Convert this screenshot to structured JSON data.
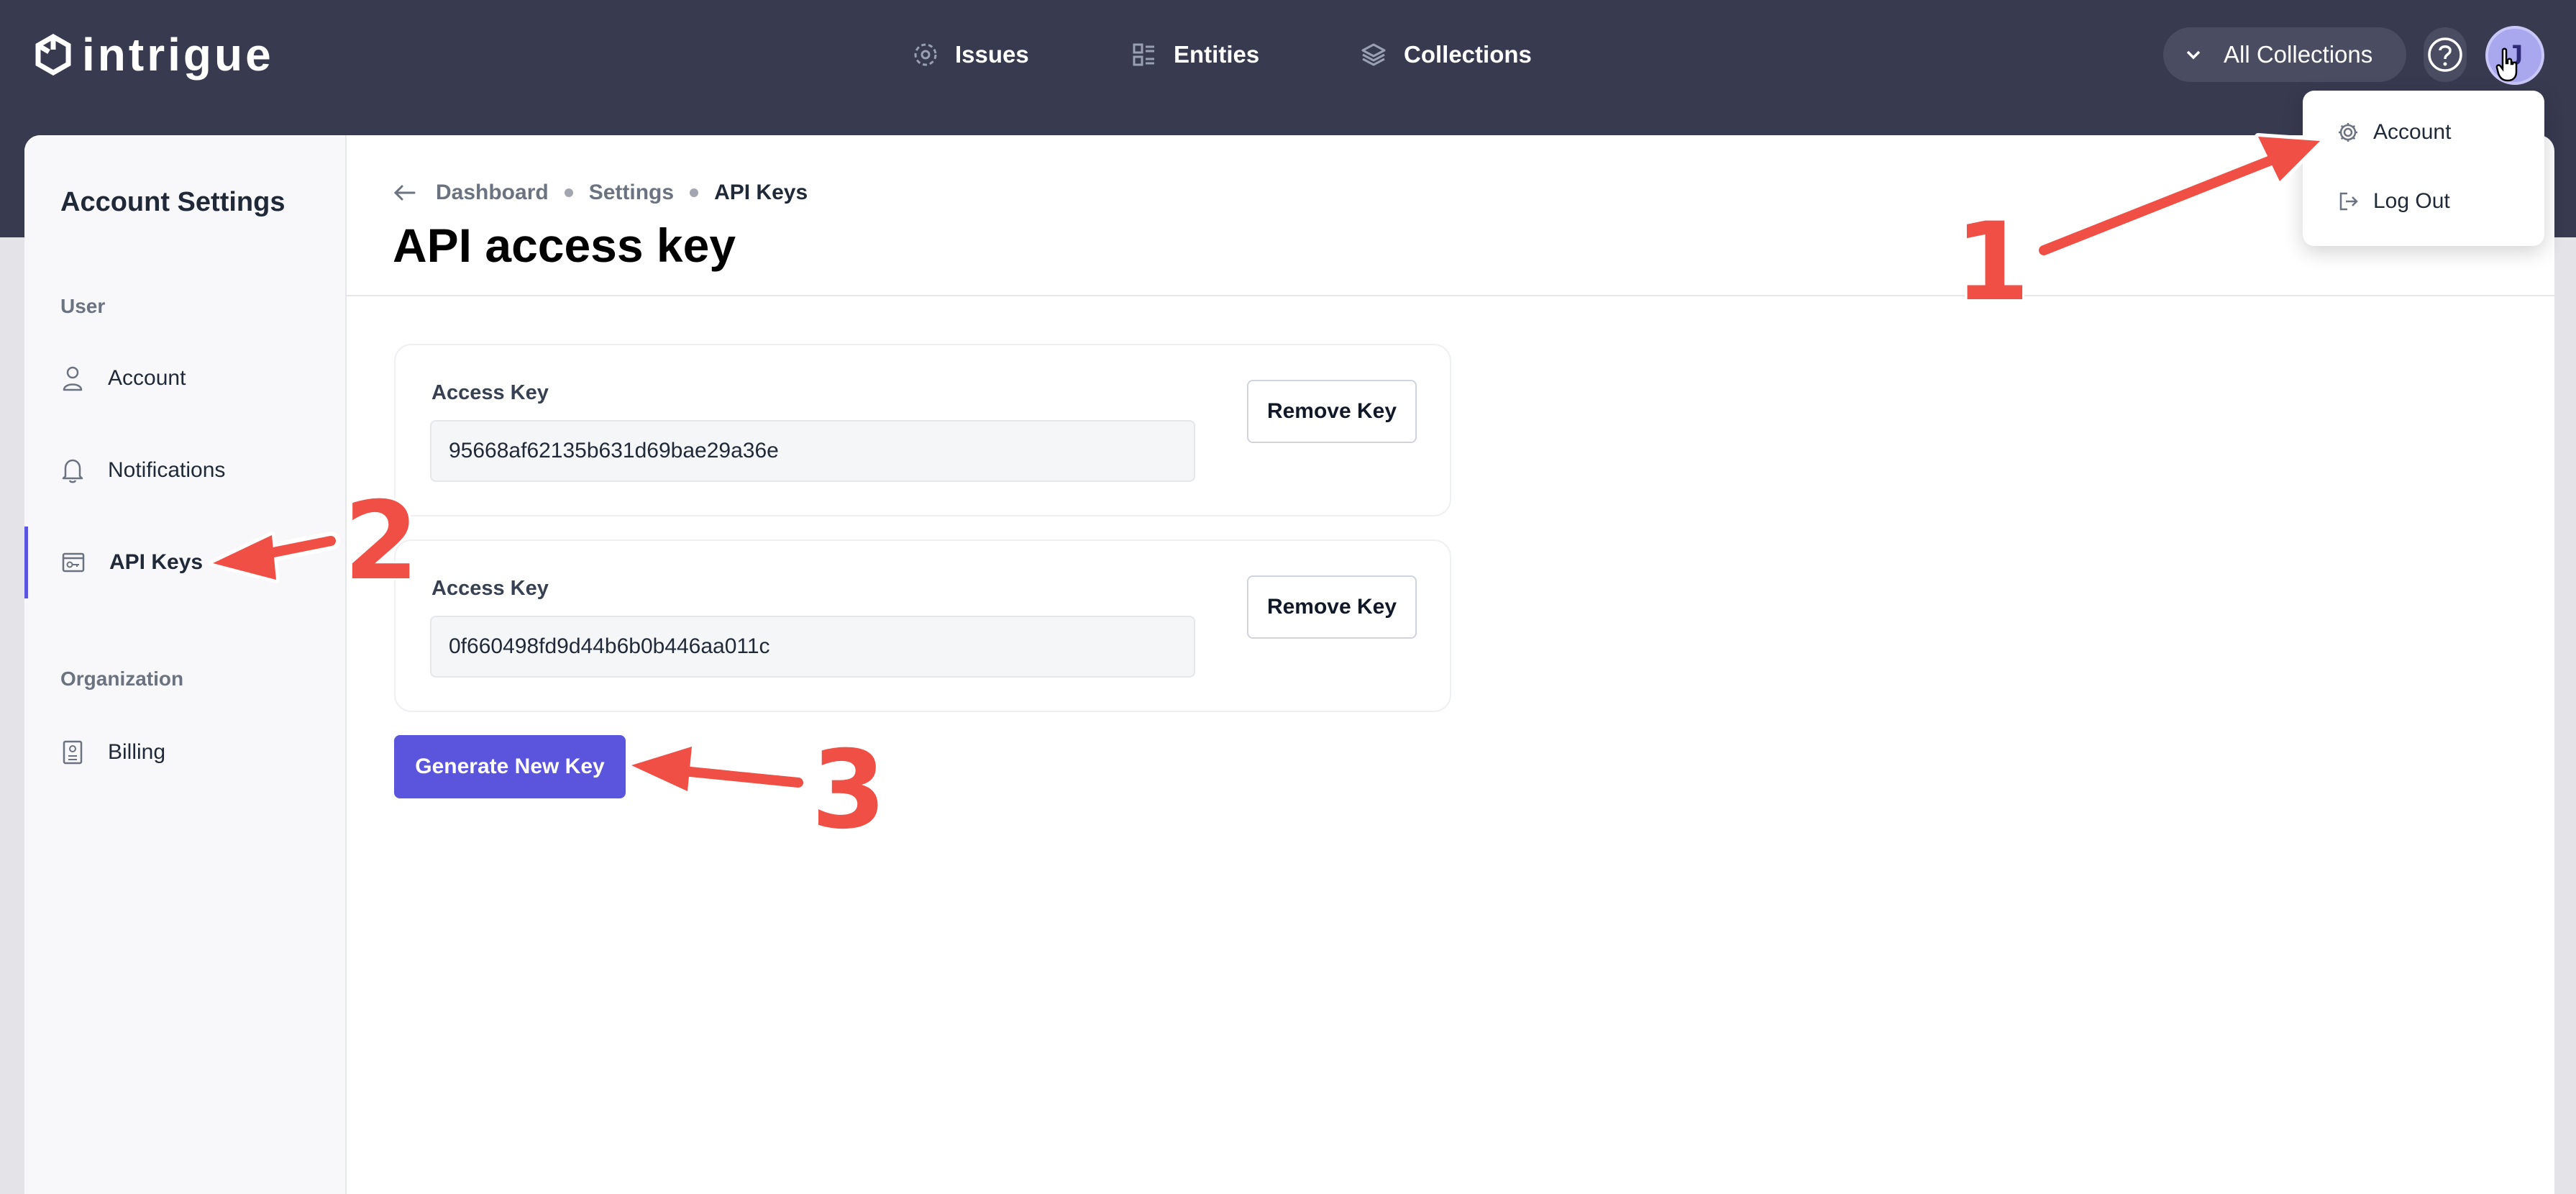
{
  "app": {
    "logo_text": "intrigue"
  },
  "nav": {
    "issues": "Issues",
    "entities": "Entities",
    "collections": "Collections",
    "collections_select": "All Collections",
    "avatar_initial": "J"
  },
  "sidebar": {
    "title": "Account Settings",
    "sections": {
      "user": "User",
      "organization": "Organization"
    },
    "items": {
      "account": "Account",
      "notifications": "Notifications",
      "api_keys": "API Keys",
      "billing": "Billing"
    }
  },
  "breadcrumb": {
    "dashboard": "Dashboard",
    "settings": "Settings",
    "current": "API Keys"
  },
  "page": {
    "title": "API access key"
  },
  "keys": [
    {
      "label": "Access Key",
      "value": "95668af62135b631d69bae29a36e",
      "remove_label": "Remove Key"
    },
    {
      "label": "Access Key",
      "value": "0f660498fd9d44b6b0b446aa011c",
      "remove_label": "Remove Key"
    }
  ],
  "actions": {
    "generate_label": "Generate New Key"
  },
  "user_menu": {
    "account": "Account",
    "logout": "Log Out"
  },
  "annotations": {
    "one": "1",
    "two": "2",
    "three": "3"
  },
  "colors": {
    "topbar": "#383a50",
    "accent": "#5b55dd",
    "annotation": "#ef4f45"
  }
}
